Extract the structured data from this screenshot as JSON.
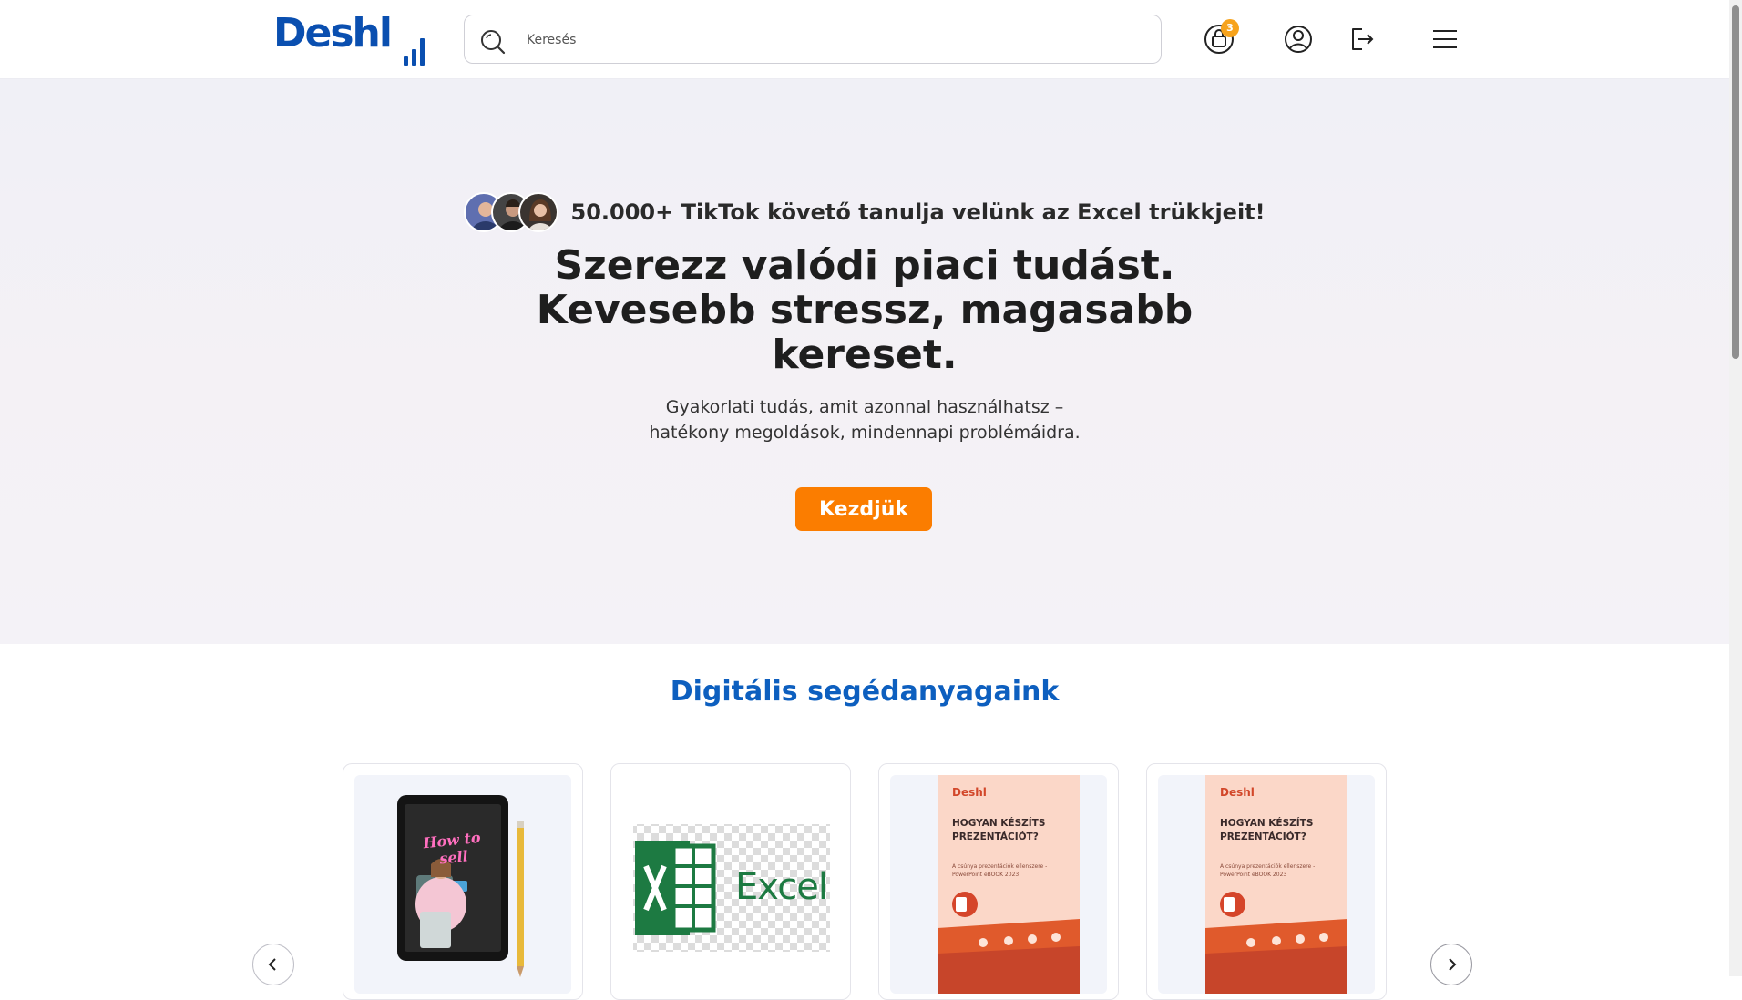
{
  "header": {
    "logo": "Deshl",
    "search": {
      "placeholder": "Keresés",
      "value": ""
    },
    "cart_count": "3",
    "icons": [
      "cart-icon",
      "user-icon",
      "logout-icon",
      "menu-icon"
    ]
  },
  "hero": {
    "social_proof": "50.000+ TikTok követő tanulja velünk az Excel trükkjeit!",
    "title_lines": [
      "Szerezz valódi piaci tudást.",
      "Kevesebb stressz, magasabb",
      "kereset."
    ],
    "subtitle_lines": [
      "Gyakorlati tudás, amit azonnal használhatsz –",
      "hatékony megoldások, mindennapi problémáidra."
    ],
    "cta": "Kezdjük"
  },
  "products": {
    "title": "Digitális segédanyagaink",
    "cards": [
      {
        "type": "tablet-book",
        "cover_text": "How to sell"
      },
      {
        "type": "excel",
        "label": "Excel"
      },
      {
        "type": "ebook",
        "brand": "Deshl",
        "title": "HOGYAN KÉSZÍTS PREZENTÁCIÓT?",
        "desc": "A csúnya prezentációk ellenszere - PowerPoint eBOOK 2023"
      },
      {
        "type": "ebook",
        "brand": "Deshl",
        "title": "HOGYAN KÉSZÍTS PREZENTÁCIÓT?",
        "desc": "A csúnya prezentációk ellenszere - PowerPoint eBOOK 2023"
      }
    ]
  },
  "colors": {
    "brand": "#0a4fb0",
    "cta": "#fb7d00",
    "badge": "#f7a31c",
    "section_title": "#0d5fbf"
  }
}
